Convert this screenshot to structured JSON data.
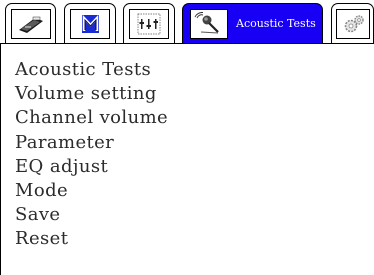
{
  "tabs": [
    {
      "id": "tab-device",
      "icon": "device-icon",
      "active": false
    },
    {
      "id": "tab-logo",
      "icon": "m-logo-icon",
      "active": false
    },
    {
      "id": "tab-tools",
      "icon": "tools-panel-icon",
      "active": false
    },
    {
      "id": "tab-acoustic",
      "icon": "microphone-icon",
      "label": "Acoustic Tests",
      "active": true
    },
    {
      "id": "tab-settings",
      "icon": "gears-icon",
      "active": false
    }
  ],
  "menu": {
    "items": [
      "Acoustic Tests",
      "Volume setting",
      "Channel volume",
      "Parameter",
      "EQ adjust",
      "Mode",
      "Save",
      "Reset"
    ]
  },
  "colors": {
    "active_tab": "#1800f5",
    "logo_blue": "#1a2bd6",
    "text": "#2b2b2b"
  }
}
